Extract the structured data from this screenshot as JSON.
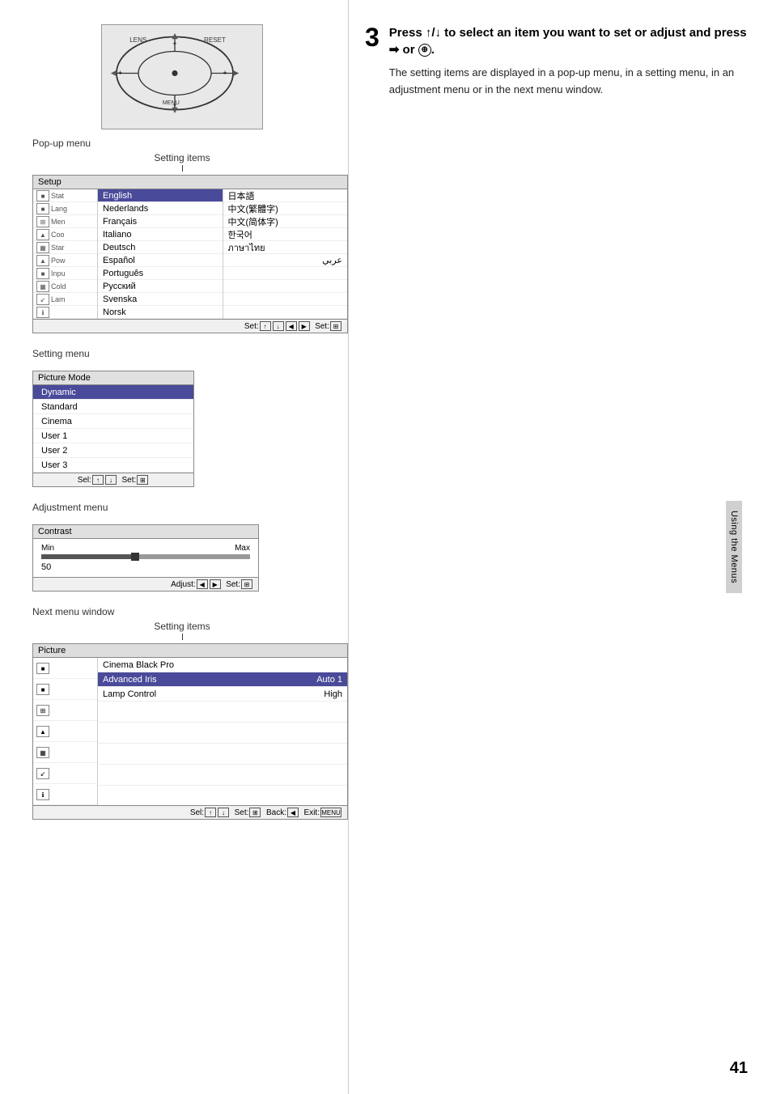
{
  "page": {
    "number": "41",
    "side_tab": "Using the Menus"
  },
  "left": {
    "popup_menu_label": "Pop-up menu",
    "setting_items_label": "Setting items",
    "popup_menu": {
      "title": "Setup",
      "icons": [
        "■",
        "■",
        "⊞",
        "▲",
        "▦",
        "↙",
        "ℹ"
      ],
      "icon_labels": [
        "",
        "Lang",
        "Men",
        "Coo",
        "Star",
        "Pow",
        "Inpu",
        "Cold",
        "Lam"
      ],
      "languages_col1": [
        "English",
        "Nederlands",
        "Français",
        "Italiano",
        "Deutsch",
        "Español",
        "Português",
        "Русский",
        "Svenska",
        "Norsk"
      ],
      "languages_col2": [
        "日本語",
        "中文(繁體字)",
        "中文(简体字)",
        "한국어",
        "ภาษาไทย",
        "عربي"
      ],
      "footer": "Set:⬆⬇◀▶  Set:⊞"
    },
    "setting_menu_label": "Setting menu",
    "setting_menu": {
      "title": "Picture Mode",
      "items": [
        "Dynamic",
        "Standard",
        "Cinema",
        "User 1",
        "User 2",
        "User 3"
      ],
      "highlighted": "Dynamic",
      "footer": "Sel:⬆⬇  Set:⊞"
    },
    "adj_menu_label": "Adjustment menu",
    "adj_menu": {
      "title": "Contrast",
      "min_label": "Min",
      "max_label": "Max",
      "value": "50",
      "footer": "Adjust:◀▶  Set:⊞"
    },
    "next_menu_label": "Next menu window",
    "next_menu": {
      "title": "Picture",
      "icons": [
        "■",
        "■",
        "⊞",
        "▲",
        "▦",
        "↙",
        "ℹ"
      ],
      "rows": [
        {
          "label": "Cinema Black Pro",
          "value": "",
          "highlighted": false
        },
        {
          "label": "Advanced Iris",
          "value": "Auto 1",
          "highlighted": true
        },
        {
          "label": "Lamp Control",
          "value": "High",
          "highlighted": false
        }
      ],
      "footer": "Sel:⬆⬇  Set:⊞  Back:◀  Exit:MENU"
    }
  },
  "right": {
    "step_number": "3",
    "step_title": "Press ↑/↓ to select an item you want to set or adjust and press",
    "step_or": "or",
    "step_description": "The setting items are displayed in a pop-up menu, in a setting menu, in an adjustment menu or in the next menu window."
  }
}
